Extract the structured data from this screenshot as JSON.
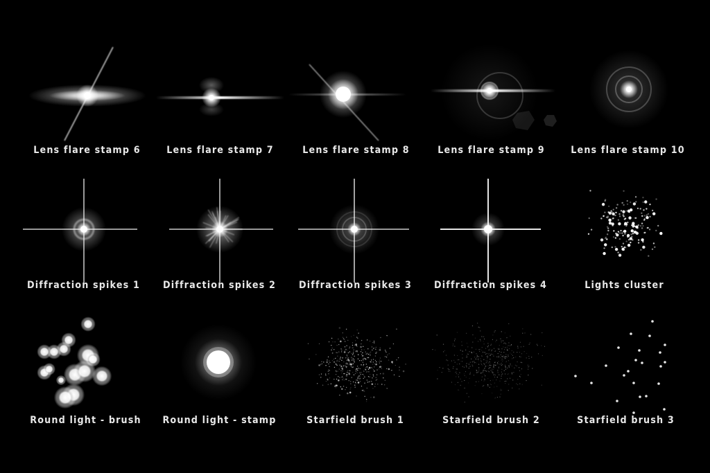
{
  "page": {
    "background": "#000000",
    "text_color": "#e8e8e8"
  },
  "rows": [
    {
      "items": [
        {
          "id": "lens-flare-stamp-6",
          "label": "Lens flare stamp 6",
          "effect": "anamorphic-flare-diagonal"
        },
        {
          "id": "lens-flare-stamp-7",
          "label": "Lens flare stamp 7",
          "effect": "anamorphic-flare-streaks"
        },
        {
          "id": "lens-flare-stamp-8",
          "label": "Lens flare stamp 8",
          "effect": "bright-star-diagonal"
        },
        {
          "id": "lens-flare-stamp-9",
          "label": "Lens flare stamp 9",
          "effect": "flare-with-rings-hexagons"
        },
        {
          "id": "lens-flare-stamp-10",
          "label": "Lens flare stamp 10",
          "effect": "concentric-halo"
        }
      ]
    },
    {
      "items": [
        {
          "id": "diffraction-spikes-1",
          "label": "Diffraction spikes 1",
          "effect": "cross-spikes-halo"
        },
        {
          "id": "diffraction-spikes-2",
          "label": "Diffraction spikes 2",
          "effect": "cross-spikes-starburst"
        },
        {
          "id": "diffraction-spikes-3",
          "label": "Diffraction spikes 3",
          "effect": "cross-spikes-rings"
        },
        {
          "id": "diffraction-spikes-4",
          "label": "Diffraction spikes 4",
          "effect": "cross-spikes-sharp"
        },
        {
          "id": "lights-cluster",
          "label": "Lights cluster",
          "effect": "dense-dot-cluster"
        }
      ]
    },
    {
      "items": [
        {
          "id": "round-light-brush",
          "label": "Round light - brush",
          "effect": "bokeh-dots"
        },
        {
          "id": "round-light-stamp",
          "label": "Round light - stamp",
          "effect": "single-round-glow"
        },
        {
          "id": "starfield-brush-1",
          "label": "Starfield brush 1",
          "effect": "starfield-dense"
        },
        {
          "id": "starfield-brush-2",
          "label": "Starfield brush 2",
          "effect": "starfield-faint"
        },
        {
          "id": "starfield-brush-3",
          "label": "Starfield brush 3",
          "effect": "starfield-sparse"
        }
      ]
    }
  ]
}
